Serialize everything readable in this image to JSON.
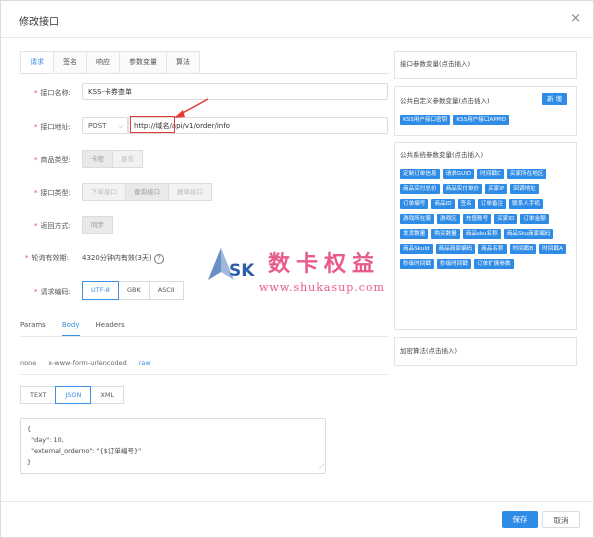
{
  "dialog": {
    "title": "修改接口",
    "close": "×"
  },
  "tabs": [
    "请求",
    "签名",
    "响应",
    "参数变量",
    "算法"
  ],
  "form": {
    "name_label": "接口名称:",
    "name_value": "KSS-卡券查单",
    "url_label": "接口地址:",
    "method": "POST",
    "url_prefix": "http://域名",
    "url_path": "/api/v1/order/info",
    "product_type_label": "商品类型:",
    "product_types": [
      "卡密",
      "直充"
    ],
    "interface_type_label": "接口类型:",
    "interface_types": [
      "下单接口",
      "查询接口",
      "报单接口"
    ],
    "callback_label": "返回方式:",
    "callback_types": [
      "同步"
    ],
    "polling_label": "轮询有效期:",
    "polling_value": "4320分钟内有效(3天)",
    "encoding_label": "请求编码:",
    "encodings": [
      "UTF-8",
      "GBK",
      "ASCII"
    ]
  },
  "subtabs": [
    "Params",
    "Body",
    "Headers"
  ],
  "body_types": [
    "none",
    "x-www-form-urlencoded",
    "raw"
  ],
  "formats": [
    "TEXT",
    "JSON",
    "XML"
  ],
  "code_lines": [
    "{",
    "  \"day\": 10,",
    "  \"external_orderno\": \"{$订单编号}\"",
    "}"
  ],
  "right": {
    "panel1_title": "接口参数变量(点击插入)",
    "panel2_title": "公共自定义参数变量(点击插入)",
    "add_button": "新 增",
    "custom_chips": [
      "KSS用户接口密钥",
      "KSS用户接口APPID"
    ],
    "panel3_title": "公共系统参数变量(点击插入)",
    "system_chips": [
      "定制订单信息",
      "请求GUID",
      "时间戳C",
      "买家所在地区",
      "商品实付总价",
      "商品实付单价",
      "买家IP",
      "回调地址",
      "订单编号",
      "商品ID",
      "签名",
      "订单备注",
      "联系人手机",
      "游戏所在服",
      "游戏区",
      "充值账号",
      "买家ID",
      "订单金额",
      "发货数量",
      "购买数量",
      "商品sku名称",
      "商品Sku商家编码",
      "商品SkuId",
      "商品商家编码",
      "商品名称",
      "时间戳B",
      "时间戳A",
      "秒级时间戳",
      "秒级时间戳",
      "订单扩展参数"
    ],
    "panel4_title": "加密算法(点击插入)"
  },
  "footer": {
    "save": "保存",
    "cancel": "取消"
  },
  "watermark": {
    "logo": "SK",
    "cn": "数卡权益",
    "url": "www.shukasup.com"
  },
  "colors": {
    "accent": "#2e8be6",
    "required": "#e74c3c",
    "annotation": "#e53935"
  }
}
